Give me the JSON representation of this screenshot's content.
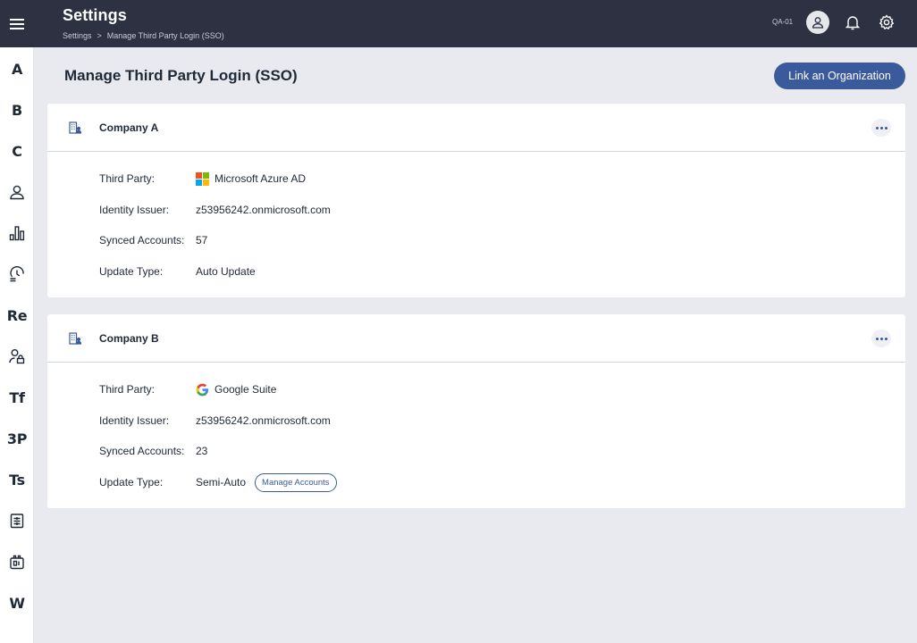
{
  "header": {
    "title": "Settings",
    "breadcrumb": [
      "Settings",
      ">",
      "Manage Third Party Login (SSO)"
    ],
    "user_label": "QA-01"
  },
  "sidebar": {
    "items": [
      {
        "label": "A"
      },
      {
        "label": "B"
      },
      {
        "label": "C"
      },
      {
        "label": "",
        "icon": "user-icon"
      },
      {
        "label": "",
        "icon": "bar-chart-icon"
      },
      {
        "label": "",
        "icon": "history-icon"
      },
      {
        "label": "Re"
      },
      {
        "label": "",
        "icon": "user-lock-icon"
      },
      {
        "label": "Tf"
      },
      {
        "label": "3P"
      },
      {
        "label": "Ts"
      },
      {
        "label": "",
        "icon": "checklist-icon"
      },
      {
        "label": "",
        "icon": "device-icon"
      },
      {
        "label": "W"
      }
    ]
  },
  "main": {
    "title": "Manage Third Party Login (SSO)",
    "link_button": "Link an Organization"
  },
  "labels": {
    "third_party": "Third Party:",
    "identity_issuer": "Identity Issuer:",
    "synced_accounts": "Synced Accounts:",
    "update_type": "Update Type:"
  },
  "companies": [
    {
      "name": "Company A",
      "third_party": "Microsoft Azure AD",
      "third_party_icon": "microsoft-icon",
      "identity_issuer": "z53956242.onmicrosoft.com",
      "synced_accounts": "57",
      "update_type": "Auto Update"
    },
    {
      "name": "Company B",
      "third_party": "Google Suite",
      "third_party_icon": "google-icon",
      "identity_issuer": "z53956242.onmicrosoft.com",
      "synced_accounts": "23",
      "update_type": "Semi-Auto",
      "manage_button": "Manage Accounts"
    }
  ],
  "colors": {
    "header_bg": "#2d3142",
    "accent": "#3a5a9b",
    "page_bg": "#e9eaef"
  }
}
